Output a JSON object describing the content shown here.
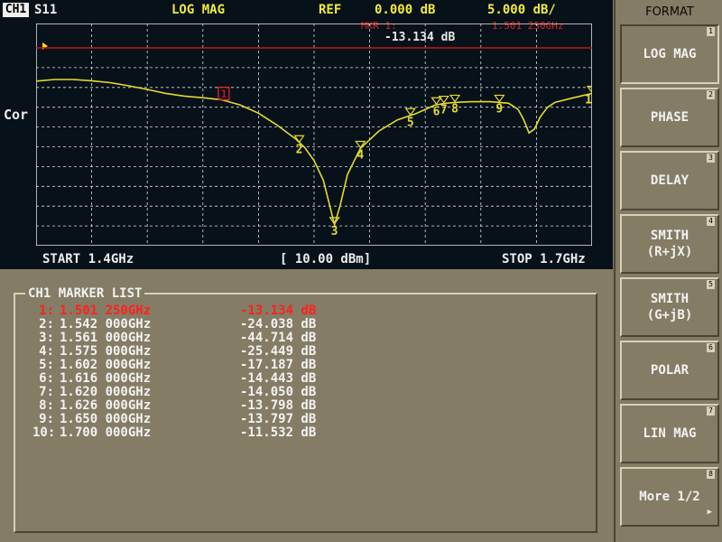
{
  "header": {
    "channel": "CH1",
    "parameter": "S11",
    "format": "LOG MAG",
    "ref_label": "REF",
    "ref_value": "0.000 dB",
    "scale": "5.000 dB/",
    "marker_label": "MKR  1:",
    "marker_value": "-13.134 dB",
    "marker_freq": "1.501 250GHz"
  },
  "side_label": "Cor",
  "footer": {
    "start": "START 1.4GHz",
    "power": "[ 10.00 dBm]",
    "stop": "STOP 1.7GHz"
  },
  "colors": {
    "trace": "#e6da2a",
    "grid": "#dcdcdc",
    "ref_line": "#c81414",
    "active_marker": "#ff2020"
  },
  "chart_data": {
    "type": "line",
    "x_unit": "GHz",
    "y_unit": "dB",
    "xlim": [
      1.4,
      1.7
    ],
    "ylim": [
      -50,
      0
    ],
    "grid": true,
    "reference_line": 0,
    "series": [
      {
        "x": [
          1.4,
          1.41,
          1.42,
          1.43,
          1.44,
          1.45,
          1.46,
          1.47,
          1.48,
          1.49,
          1.5,
          1.51,
          1.52,
          1.53,
          1.54,
          1.545,
          1.55,
          1.555,
          1.558,
          1.561,
          1.564,
          1.568,
          1.575,
          1.585,
          1.595,
          1.605,
          1.615,
          1.62,
          1.626,
          1.635,
          1.645,
          1.655,
          1.66,
          1.663,
          1.666,
          1.669,
          1.672,
          1.676,
          1.68,
          1.69,
          1.7
        ],
        "y": [
          -8.4,
          -8.0,
          -8.0,
          -8.3,
          -8.8,
          -9.6,
          -10.5,
          -11.5,
          -12.2,
          -12.6,
          -13.1,
          -14.4,
          -16.5,
          -19.5,
          -23.0,
          -25.2,
          -28.5,
          -33.5,
          -39.0,
          -44.7,
          -40.0,
          -32.0,
          -25.4,
          -21.0,
          -18.2,
          -16.6,
          -14.5,
          -14.05,
          -13.8,
          -13.6,
          -13.6,
          -14.0,
          -15.5,
          -18.0,
          -21.5,
          -20.5,
          -17.5,
          -15.0,
          -13.8,
          -12.6,
          -11.5
        ]
      }
    ],
    "markers": [
      {
        "id": "1",
        "x": 1.50125,
        "y": -13.134
      },
      {
        "id": "2",
        "x": 1.542,
        "y": -24.038
      },
      {
        "id": "3",
        "x": 1.561,
        "y": -44.714
      },
      {
        "id": "4",
        "x": 1.575,
        "y": -25.449
      },
      {
        "id": "5",
        "x": 1.602,
        "y": -17.187
      },
      {
        "id": "6",
        "x": 1.616,
        "y": -14.443
      },
      {
        "id": "7",
        "x": 1.62,
        "y": -14.05
      },
      {
        "id": "8",
        "x": 1.626,
        "y": -13.798
      },
      {
        "id": "9",
        "x": 1.65,
        "y": -13.797
      },
      {
        "id": "10",
        "x": 1.7,
        "y": -11.532
      }
    ]
  },
  "marker_list": {
    "title": "CH1 MARKER LIST",
    "rows": [
      {
        "index": "1:",
        "freq": "1.501 250GHz",
        "value": "-13.134 dB",
        "active": true
      },
      {
        "index": "2:",
        "freq": "1.542 000GHz",
        "value": "-24.038 dB"
      },
      {
        "index": "3:",
        "freq": "1.561 000GHz",
        "value": "-44.714 dB"
      },
      {
        "index": "4:",
        "freq": "1.575 000GHz",
        "value": "-25.449 dB"
      },
      {
        "index": "5:",
        "freq": "1.602 000GHz",
        "value": "-17.187 dB"
      },
      {
        "index": "6:",
        "freq": "1.616 000GHz",
        "value": "-14.443 dB"
      },
      {
        "index": "7:",
        "freq": "1.620 000GHz",
        "value": "-14.050 dB"
      },
      {
        "index": "8:",
        "freq": "1.626 000GHz",
        "value": "-13.798 dB"
      },
      {
        "index": "9:",
        "freq": "1.650 000GHz",
        "value": "-13.797 dB"
      },
      {
        "index": "10:",
        "freq": "1.700 000GHz",
        "value": "-11.532 dB"
      }
    ]
  },
  "softkeys": {
    "title": "FORMAT",
    "keys": [
      {
        "label": "LOG MAG",
        "num": "1",
        "selected": true
      },
      {
        "label": "PHASE",
        "num": "2"
      },
      {
        "label": "DELAY",
        "num": "3"
      },
      {
        "label": "SMITH\n(R+jX)",
        "num": "4"
      },
      {
        "label": "SMITH\n(G+jB)",
        "num": "5"
      },
      {
        "label": "POLAR",
        "num": "6"
      },
      {
        "label": "LIN MAG",
        "num": "7"
      },
      {
        "label": "More 1/2",
        "num": "8",
        "more": true
      }
    ]
  }
}
